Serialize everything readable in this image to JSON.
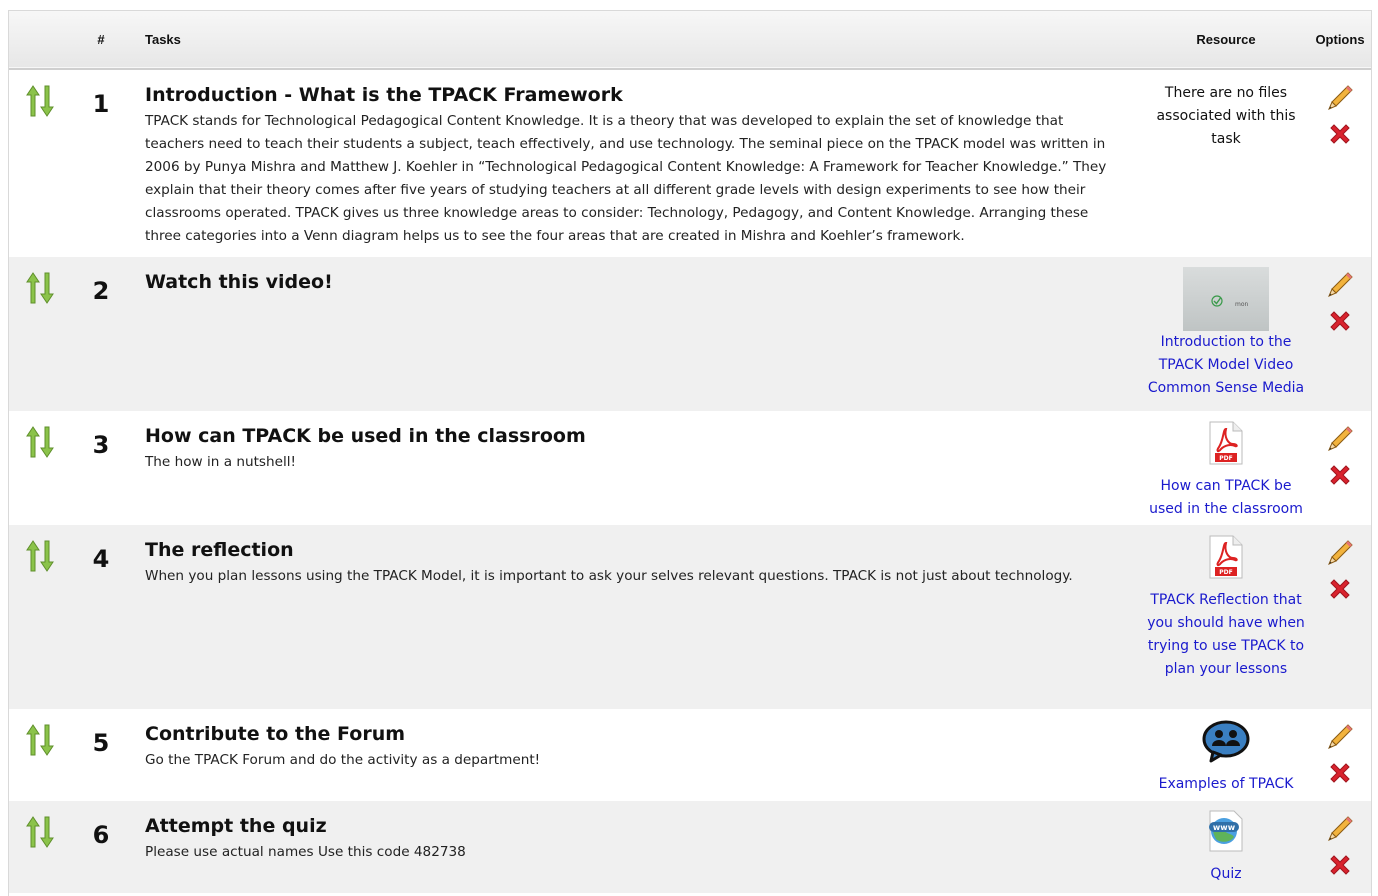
{
  "header": {
    "num_label": "#",
    "tasks_label": "Tasks",
    "resource_label": "Resource",
    "options_label": "Options"
  },
  "rows": [
    {
      "number": "1",
      "title": "Introduction - What is the TPACK Framework",
      "description": "TPACK stands for Technological Pedagogical Content Knowledge. It is a theory that was developed to explain the set of knowledge that teachers need to teach their students a subject, teach effectively, and use technology. The seminal piece on the TPACK model was written in 2006 by Punya Mishra and Matthew J. Koehler in “Technological Pedagogical Content Knowledge: A Framework for Teacher Knowledge.” They explain that their theory comes after five years of studying teachers at all different grade levels with design experiments to see how their classrooms operated. TPACK gives us three knowledge areas to consider: Technology, Pedagogy, and Content Knowledge. Arranging these three categories into a Venn diagram helps us to see the four areas that are created in Mishra and Koehler’s framework.",
      "resource_type": "none",
      "resource_text": "There are no files associated with this task"
    },
    {
      "number": "2",
      "title": "Watch this video!",
      "description": "",
      "resource_type": "video",
      "resource_text": "Introduction to the TPACK Model Video Common Sense Media",
      "thumb_text": "mon"
    },
    {
      "number": "3",
      "title": "How can TPACK be used in the classroom",
      "description": "The how in a nutshell!",
      "resource_type": "pdf",
      "resource_text": "How can TPACK be used in the classroom"
    },
    {
      "number": "4",
      "title": "The reflection",
      "description": "When you plan lessons using the TPACK Model, it is important to ask your selves relevant questions. TPACK is not just about technology.",
      "resource_type": "pdf",
      "resource_text": "TPACK Reflection that you should have when trying to use TPACK to plan your lessons"
    },
    {
      "number": "5",
      "title": "Contribute to the Forum",
      "description": "Go the TPACK Forum and do the activity as a department!",
      "resource_type": "forum",
      "resource_text": "Examples of TPACK"
    },
    {
      "number": "6",
      "title": "Attempt the quiz",
      "description": "Please use actual names Use this code 482738",
      "resource_type": "web",
      "resource_text": "Quiz"
    }
  ],
  "icons": {
    "move": "move-up-down-icon",
    "edit": "pencil-edit-icon",
    "delete": "red-x-delete-icon",
    "pdf": "pdf-file-icon",
    "forum": "forum-chat-icon",
    "web": "www-globe-icon"
  },
  "colors": {
    "link": "#1a1acd",
    "move_arrows": "#8bc34a",
    "delete": "#d9232e",
    "row_alt": "#f0f0f0"
  }
}
